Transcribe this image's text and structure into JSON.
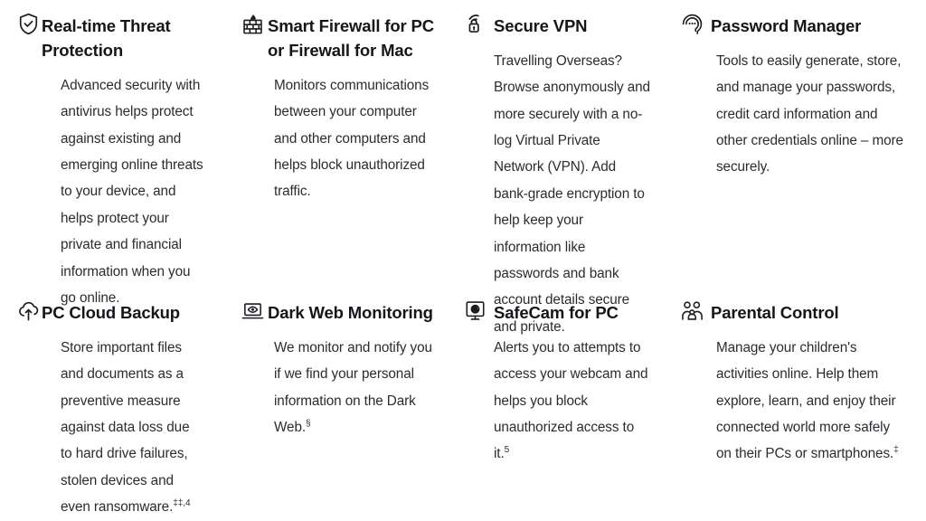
{
  "theme": {
    "background": "#ffffff",
    "heading_color": "#15161a",
    "body_color": "#2b2c31",
    "icon_color": "#1c1d21"
  },
  "features": [
    {
      "icon": "shield-check-icon",
      "title": "Real-time Threat Protection",
      "body": "Advanced security with antivirus helps protect against existing and emerging online threats to your device, and helps protect your private and financial information when you go online.",
      "footnote": ""
    },
    {
      "icon": "firewall-brick-flame-icon",
      "title": "Smart Firewall for PC or Firewall for Mac",
      "body": "Monitors communications between your computer and other computers and helps block unauthorized traffic.",
      "footnote": ""
    },
    {
      "icon": "vpn-lock-signal-icon",
      "title": "Secure VPN",
      "body": "Travelling Overseas? Browse anonymously and more securely with a no-log Virtual Private Network (VPN). Add bank-grade encryption to help keep your information like passwords and bank account details secure and private.",
      "footnote": ""
    },
    {
      "icon": "password-manager-dots-icon",
      "title": "Password Manager",
      "body": "Tools to easily generate, store, and manage your passwords, credit card information and other credentials online – more securely.",
      "footnote": ""
    },
    {
      "icon": "cloud-upload-icon",
      "title": "PC Cloud Backup",
      "body": "Store important files and documents as a preventive measure against data loss due to hard drive failures, stolen devices and even ransomware.",
      "footnote": "‡‡,4"
    },
    {
      "icon": "laptop-eye-icon",
      "title": "Dark Web Monitoring",
      "body": "We monitor and notify you if we find your personal information on the Dark Web.",
      "footnote": "§"
    },
    {
      "icon": "webcam-icon",
      "title": "SafeCam for PC",
      "body": "Alerts you to attempts to access your webcam and helps you block unauthorized access to it.",
      "footnote": "5"
    },
    {
      "icon": "family-group-icon",
      "title": "Parental Control",
      "body": "Manage your children's activities online. Help them explore, learn, and enjoy their connected world more safely on their PCs or smartphones.",
      "footnote": "‡"
    }
  ]
}
